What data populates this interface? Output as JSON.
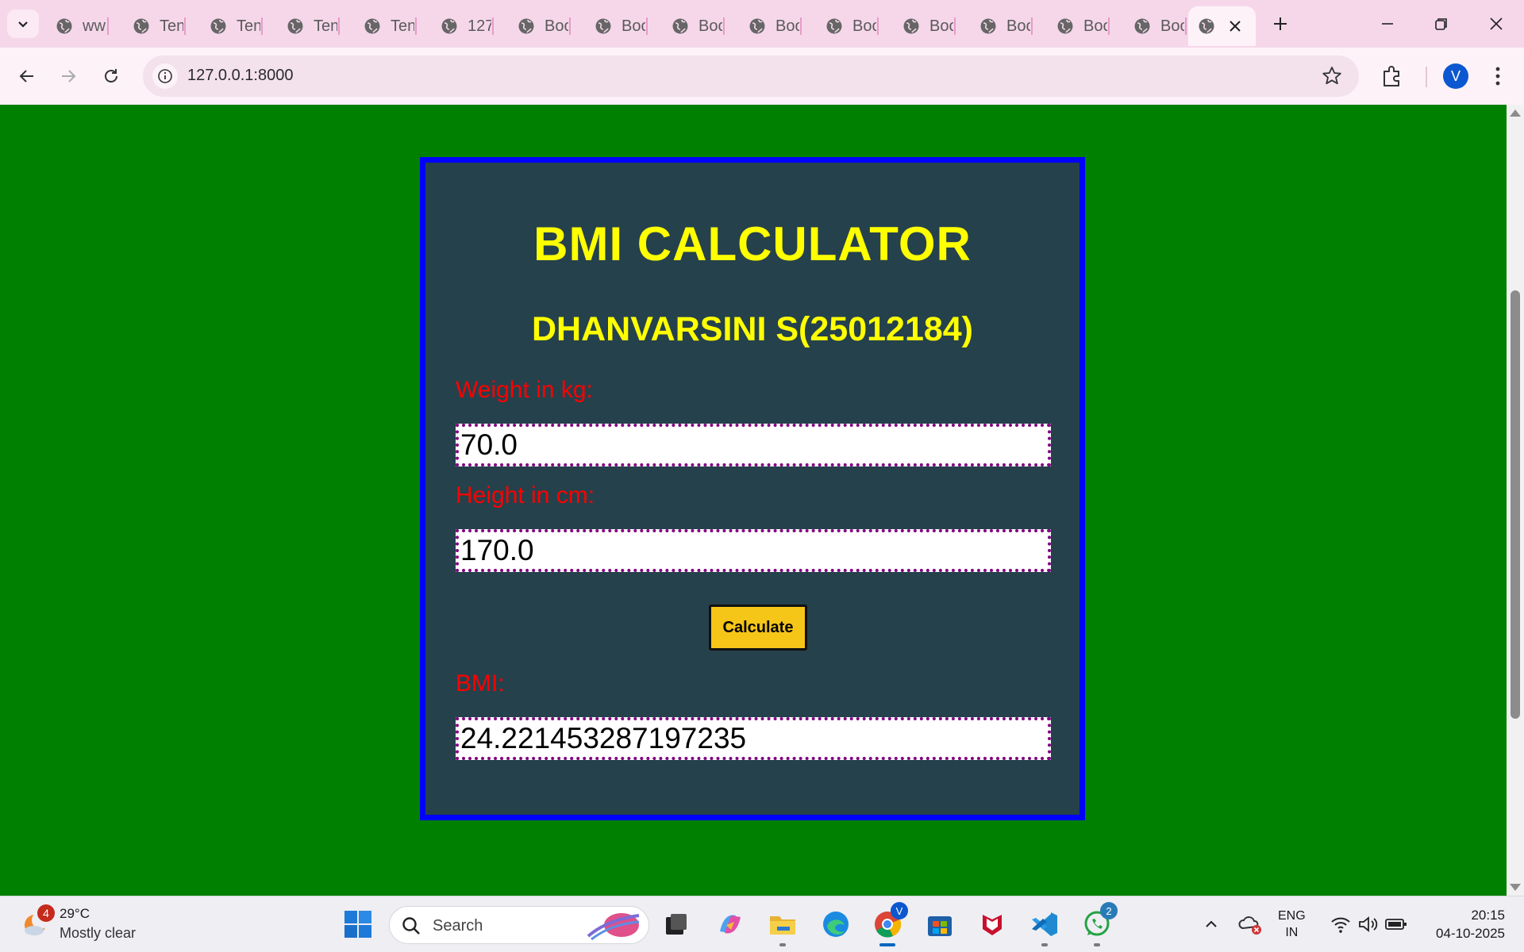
{
  "browser": {
    "tabs": [
      {
        "title": "ww"
      },
      {
        "title": "Ten"
      },
      {
        "title": "Ten"
      },
      {
        "title": "Ten"
      },
      {
        "title": "Ten"
      },
      {
        "title": "127"
      },
      {
        "title": "Boo"
      },
      {
        "title": "Boo"
      },
      {
        "title": "Boo"
      },
      {
        "title": "Boo"
      },
      {
        "title": "Boo"
      },
      {
        "title": "Boo"
      },
      {
        "title": "Boo"
      },
      {
        "title": "Boo"
      },
      {
        "title": "Boo"
      },
      {
        "title": "",
        "active": true
      }
    ],
    "url": "127.0.0.1:8000",
    "profile_initial": "V"
  },
  "page": {
    "background_color": "#008000",
    "card_border_color": "#0000ff",
    "title": "BMI CALCULATOR",
    "subtitle": "DHANVARSINI S(25012184)",
    "weight_label": "Weight in kg:",
    "weight_value": "70.0",
    "height_label": "Height in cm:",
    "height_value": "170.0",
    "calculate_label": "Calculate",
    "bmi_label": "BMI:",
    "bmi_value": "24.221453287197235"
  },
  "taskbar": {
    "weather_badge": "4",
    "weather_temp": "29°C",
    "weather_desc": "Mostly clear",
    "search_placeholder": "Search",
    "chrome_badge": "V",
    "whatsapp_badge": "2",
    "lang_line1": "ENG",
    "lang_line2": "IN",
    "time": "20:15",
    "date": "04-10-2025"
  }
}
